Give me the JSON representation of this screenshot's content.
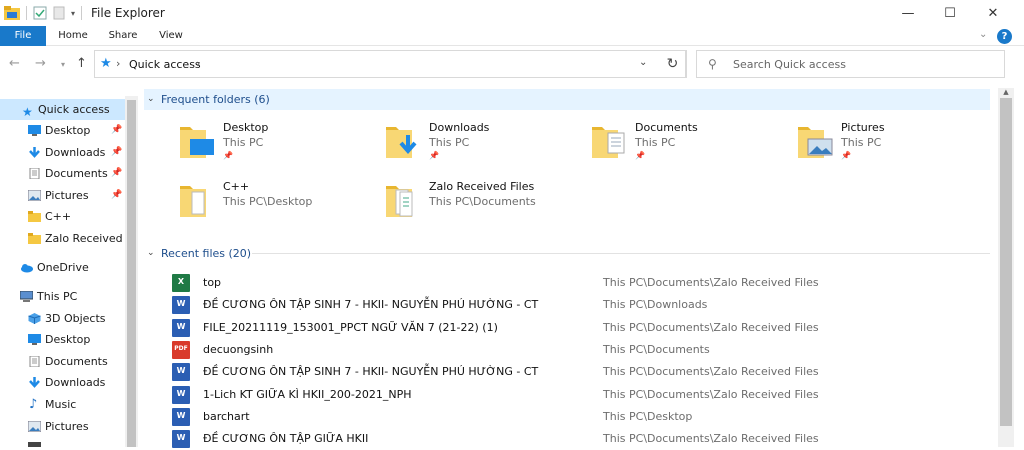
{
  "window": {
    "title": "File Explorer",
    "minimize": "—",
    "maximize": "☐",
    "close": "✕"
  },
  "ribbon": {
    "tabs": [
      "File",
      "Home",
      "Share",
      "View"
    ],
    "help": "?"
  },
  "address": {
    "crumb": "Quick access",
    "search_placeholder": "Search Quick access"
  },
  "nav": {
    "quick_access": "Quick access",
    "quick_items": [
      {
        "label": "Desktop",
        "pinned": true
      },
      {
        "label": "Downloads",
        "pinned": true
      },
      {
        "label": "Documents",
        "pinned": true
      },
      {
        "label": "Pictures",
        "pinned": true
      },
      {
        "label": "C++",
        "pinned": false
      },
      {
        "label": "Zalo Received Fi",
        "pinned": false
      }
    ],
    "onedrive": "OneDrive",
    "thispc": "This PC",
    "pc_items": [
      "3D Objects",
      "Desktop",
      "Documents",
      "Downloads",
      "Music",
      "Pictures"
    ]
  },
  "frequent": {
    "header": "Frequent folders (6)",
    "folders": [
      {
        "name": "Desktop",
        "location": "This PC",
        "pinned": true
      },
      {
        "name": "Downloads",
        "location": "This PC",
        "pinned": true
      },
      {
        "name": "Documents",
        "location": "This PC",
        "pinned": true
      },
      {
        "name": "Pictures",
        "location": "This PC",
        "pinned": true
      },
      {
        "name": "C++",
        "location": "This PC\\Desktop",
        "pinned": false
      },
      {
        "name": "Zalo Received Files",
        "location": "This PC\\Documents",
        "pinned": false
      }
    ]
  },
  "recent": {
    "header": "Recent files (20)",
    "files": [
      {
        "name": "top",
        "type": "excel",
        "path": "This PC\\Documents\\Zalo Received Files"
      },
      {
        "name": "ĐỀ CƯƠNG ÔN TẬP SINH 7 - HKII- NGUYỄN PHÚ HƯỜNG  - CT",
        "type": "word",
        "path": "This PC\\Downloads"
      },
      {
        "name": "FILE_20211119_153001_PPCT NGỮ VĂN 7 (21-22) (1)",
        "type": "word",
        "path": "This PC\\Documents\\Zalo Received Files"
      },
      {
        "name": "decuongsinh",
        "type": "pdf",
        "path": "This PC\\Documents"
      },
      {
        "name": "ĐỀ CƯƠNG ÔN TẬP SINH 7 - HKII- NGUYỄN PHÚ HƯỜNG  - CT",
        "type": "word",
        "path": "This PC\\Documents\\Zalo Received Files"
      },
      {
        "name": "1-Lich KT  GIỮA KÌ  HKII_200-2021_NPH",
        "type": "word",
        "path": "This PC\\Documents\\Zalo Received Files"
      },
      {
        "name": "barchart",
        "type": "word",
        "path": "This PC\\Desktop"
      },
      {
        "name": "ĐỀ CƯƠNG ÔN TẬP GIỮA HKII",
        "type": "word",
        "path": "This PC\\Documents\\Zalo Received Files"
      }
    ]
  },
  "colors": {
    "accent": "#1979ca",
    "selection": "#cce8ff",
    "group_header": "#1e4e8c",
    "folder": "#f5c842"
  }
}
